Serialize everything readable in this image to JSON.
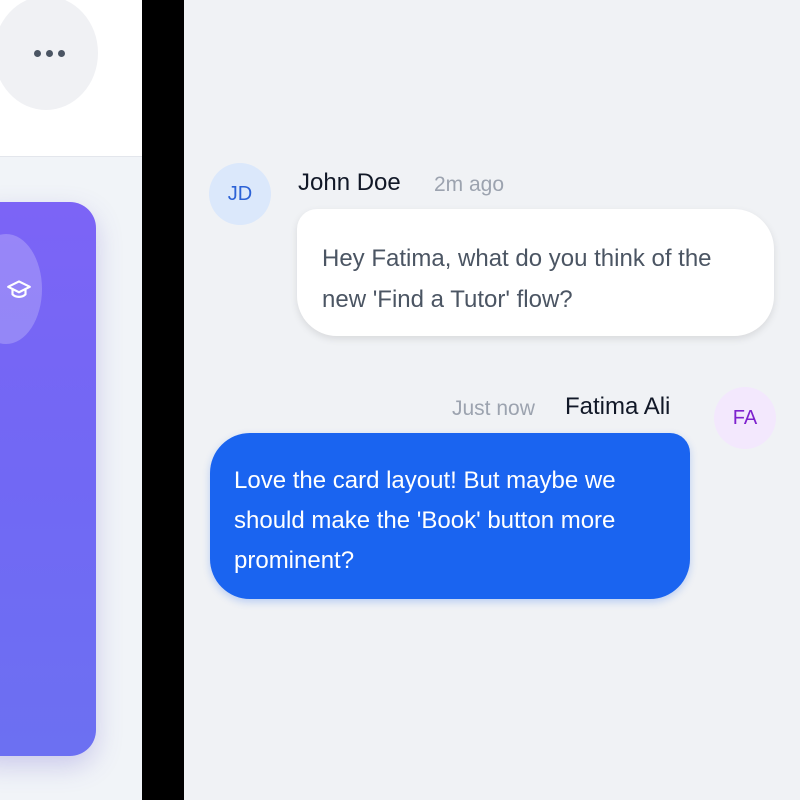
{
  "left_panel": {
    "more_button_icon": "more-horizontal-icon",
    "card_icon": "graduation-cap-icon",
    "card_color": "#7b66f5"
  },
  "chat": {
    "messages": [
      {
        "sender": "John Doe",
        "initials": "JD",
        "time": "2m ago",
        "text": "Hey Fatima, what do you think of the new 'Find a Tutor' flow?"
      },
      {
        "sender": "Fatima Ali",
        "initials": "FA",
        "time": "Just now",
        "text": "Love the card layout! But maybe we should make the 'Book' button more prominent?"
      }
    ]
  },
  "colors": {
    "outgoing_bubble": "#1a64f0",
    "incoming_bubble": "#ffffff",
    "chat_background": "#f0f2f5",
    "jd_avatar_bg": "#dbe8fb",
    "fa_avatar_bg": "#f3e8fd"
  }
}
